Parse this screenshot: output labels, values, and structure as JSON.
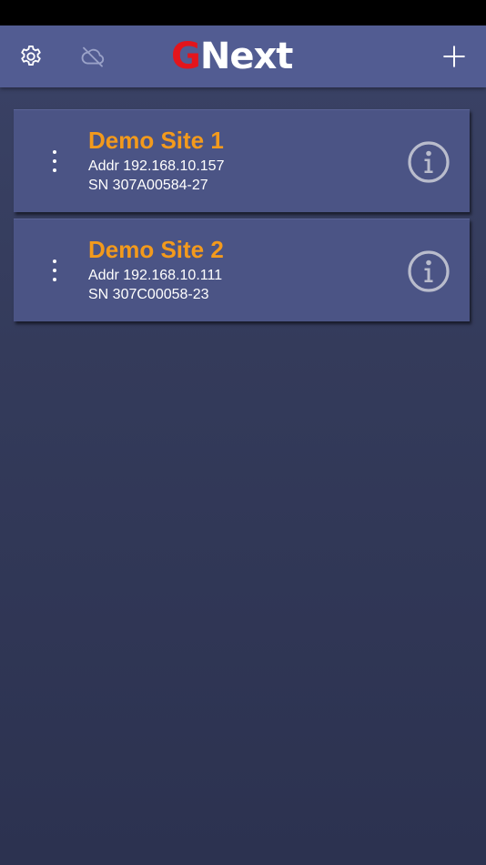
{
  "header": {
    "logo_g": "G",
    "logo_rest": "Next",
    "icons": {
      "settings": "gear-icon",
      "cloud": "cloud-off-icon",
      "add": "plus-icon"
    },
    "colors": {
      "header_bg": "#525c92",
      "logo_g": "#e3151c",
      "logo_rest": "#ffffff"
    }
  },
  "sites": [
    {
      "name": "Demo Site 1",
      "addr": "Addr 192.168.10.157",
      "sn": "SN 307A00584-27"
    },
    {
      "name": "Demo Site 2",
      "addr": "Addr 192.168.10.111",
      "sn": "SN 307C00058-23"
    }
  ],
  "colors": {
    "site_name": "#f39a1c",
    "card_bg": "#4b5485"
  }
}
